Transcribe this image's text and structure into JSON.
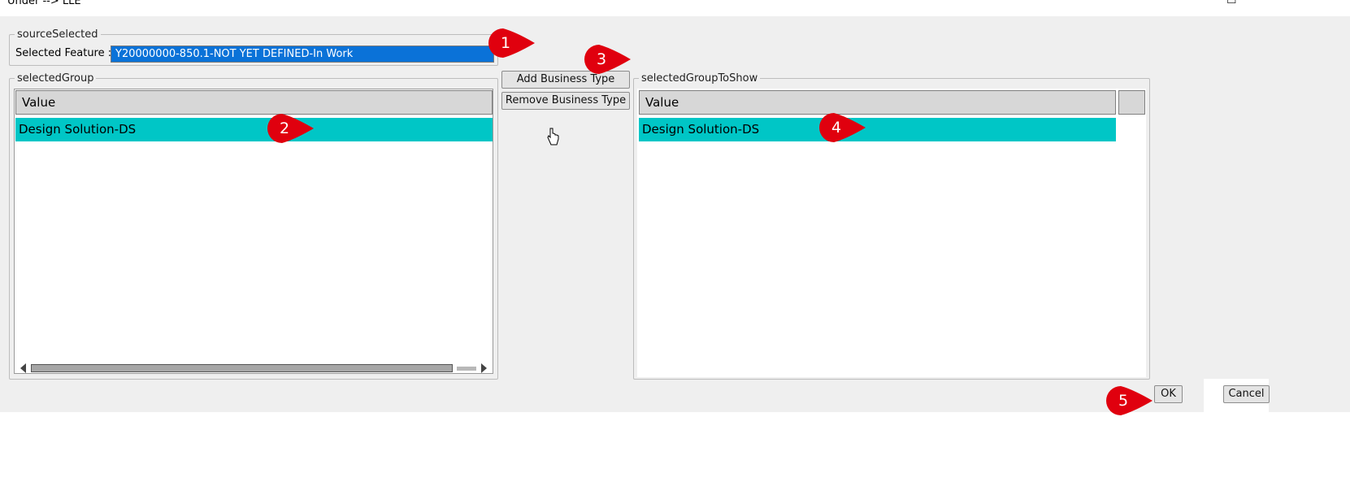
{
  "window": {
    "title": "Under --> LLE",
    "minimize_icon": "minimize-icon",
    "maximize_icon": "maximize-icon"
  },
  "source_selected": {
    "legend": "sourceSelected",
    "feature_label": "Selected Feature :",
    "feature_value": "Y20000000-850.1-NOT YET DEFINED-In Work"
  },
  "selected_group": {
    "legend": "selectedGroup",
    "column_header": "Value",
    "rows": [
      "Design Solution-DS"
    ]
  },
  "middle_buttons": {
    "add_label": "Add Business Type",
    "remove_label": "Remove Business Type"
  },
  "selected_group_to_show": {
    "legend": "selectedGroupToShow",
    "column_header": "Value",
    "rows": [
      "Design Solution-DS"
    ]
  },
  "footer": {
    "ok_label": "OK",
    "cancel_label": "Cancel"
  },
  "markers": [
    {
      "number": "1"
    },
    {
      "number": "2"
    },
    {
      "number": "3"
    },
    {
      "number": "4"
    },
    {
      "number": "5"
    }
  ],
  "colors": {
    "selection_blue": "#0a72d8",
    "row_highlight": "#00c6c6",
    "marker_red": "#e0000e",
    "dialog_bg": "#efefef"
  }
}
